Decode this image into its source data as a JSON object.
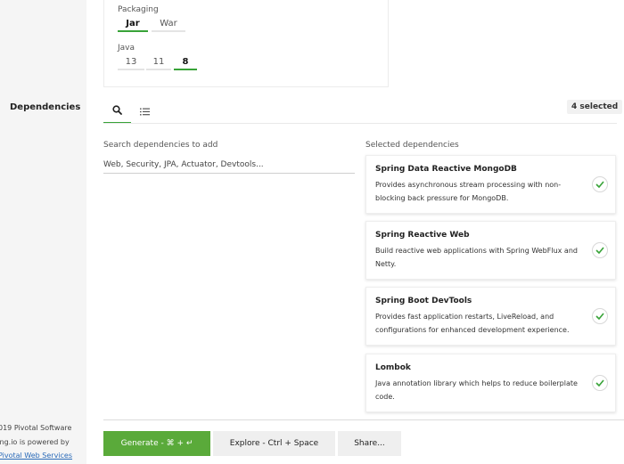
{
  "options": {
    "packaging": {
      "label": "Packaging",
      "choices": [
        "Jar",
        "War"
      ],
      "selected": "Jar"
    },
    "java": {
      "label": "Java",
      "choices": [
        "13",
        "11",
        "8"
      ],
      "selected": "8"
    }
  },
  "dependencies": {
    "section_label": "Dependencies",
    "tabs": [
      {
        "name": "search",
        "icon": "search-icon",
        "active": true
      },
      {
        "name": "list",
        "icon": "list-icon",
        "active": false
      }
    ],
    "selected_count": "4 selected",
    "search": {
      "label": "Search dependencies to add",
      "placeholder": "Web, Security, JPA, Actuator, Devtools..."
    },
    "selected_heading": "Selected dependencies",
    "items": [
      {
        "title": "Spring Data Reactive MongoDB",
        "description": "Provides asynchronous stream processing with non-blocking back pressure for MongoDB."
      },
      {
        "title": "Spring Reactive Web",
        "description": "Build reactive web applications with Spring WebFlux and Netty."
      },
      {
        "title": "Spring Boot DevTools",
        "description": "Provides fast application restarts, LiveReload, and configurations for enhanced development experience."
      },
      {
        "title": "Lombok",
        "description": "Java annotation library which helps to reduce boilerplate code."
      }
    ]
  },
  "actions": {
    "generate": "Generate - ⌘ + ↵",
    "explore": "Explore - Ctrl + Space",
    "share": "Share..."
  },
  "footer": {
    "line1": "019 Pivotal Software",
    "line2": "ring.io is powered by",
    "line3": "Pivotal Web Services"
  },
  "colors": {
    "accent": "#38a338",
    "generate_bg": "#5aaa3a",
    "sidebar_bg": "#f5f5f5"
  }
}
